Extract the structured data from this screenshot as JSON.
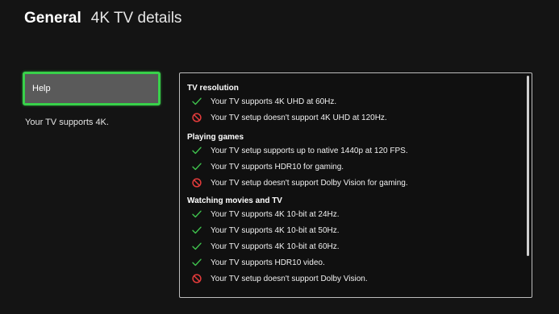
{
  "header": {
    "section": "General",
    "page": "4K TV details"
  },
  "sidebar": {
    "help_label": "Help",
    "summary": "Your TV supports 4K."
  },
  "details": {
    "sections": [
      {
        "title": "TV resolution",
        "items": [
          {
            "status": "supported",
            "icon": "check-icon",
            "text": "Your TV supports 4K UHD at 60Hz."
          },
          {
            "status": "unsupported",
            "icon": "prohibited-icon",
            "text": "Your TV setup doesn't support 4K UHD at 120Hz."
          }
        ]
      },
      {
        "title": "Playing games",
        "items": [
          {
            "status": "supported",
            "icon": "check-icon",
            "text": "Your TV setup supports up to native 1440p at 120 FPS."
          },
          {
            "status": "supported",
            "icon": "check-icon",
            "text": "Your TV supports HDR10 for gaming."
          },
          {
            "status": "unsupported",
            "icon": "prohibited-icon",
            "text": "Your TV setup doesn't support Dolby Vision for gaming."
          }
        ]
      },
      {
        "title": "Watching movies and TV",
        "items": [
          {
            "status": "supported",
            "icon": "check-icon",
            "text": "Your TV supports 4K 10-bit at 24Hz."
          },
          {
            "status": "supported",
            "icon": "check-icon",
            "text": "Your TV supports 4K 10-bit at 50Hz."
          },
          {
            "status": "supported",
            "icon": "check-icon",
            "text": "Your TV supports 4K 10-bit at 60Hz."
          },
          {
            "status": "supported",
            "icon": "check-icon",
            "text": "Your TV supports HDR10 video."
          },
          {
            "status": "unsupported",
            "icon": "prohibited-icon",
            "text": "Your TV setup doesn't support Dolby Vision."
          }
        ]
      }
    ]
  },
  "colors": {
    "focus_green": "#38d14a",
    "check_green": "#3fc24d",
    "prohibited_red": "#e23b3b",
    "background": "#141414"
  }
}
